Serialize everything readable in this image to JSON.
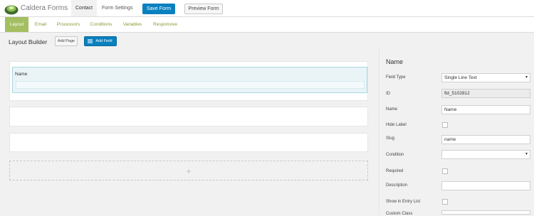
{
  "app": {
    "brand": "Caldera Forms"
  },
  "topnav": {
    "tabs": [
      {
        "label": "Contact"
      },
      {
        "label": "Form Settings"
      }
    ],
    "save_label": "Save Form",
    "preview_label": "Preview Form"
  },
  "subtabs": [
    {
      "label": "Layout"
    },
    {
      "label": "Email"
    },
    {
      "label": "Processors"
    },
    {
      "label": "Conditions"
    },
    {
      "label": "Variables"
    },
    {
      "label": "Responsive"
    }
  ],
  "builder": {
    "title": "Layout Builder",
    "add_page_label": "Add Page",
    "add_field_label": "Add Field",
    "field_card_label": "Name",
    "add_row_symbol": "+"
  },
  "sidebar": {
    "title": "Name",
    "labels": {
      "field_type": "Field Type",
      "id": "ID",
      "name": "Name",
      "hide_label": "Hide Label",
      "slug": "Slug",
      "condition": "Condition",
      "required": "Required",
      "description": "Description",
      "show_in_entry_list": "Show in Entry List",
      "custom_class": "Custom Class"
    },
    "values": {
      "field_type": "Single Line Text",
      "id": "fld_5102812",
      "name": "Name",
      "slug": "name",
      "condition": "",
      "description": ""
    }
  },
  "colors": {
    "primary": "#0a80bf",
    "subtab_active": "#a3bf61",
    "field_selected": "#eaf4f6"
  }
}
